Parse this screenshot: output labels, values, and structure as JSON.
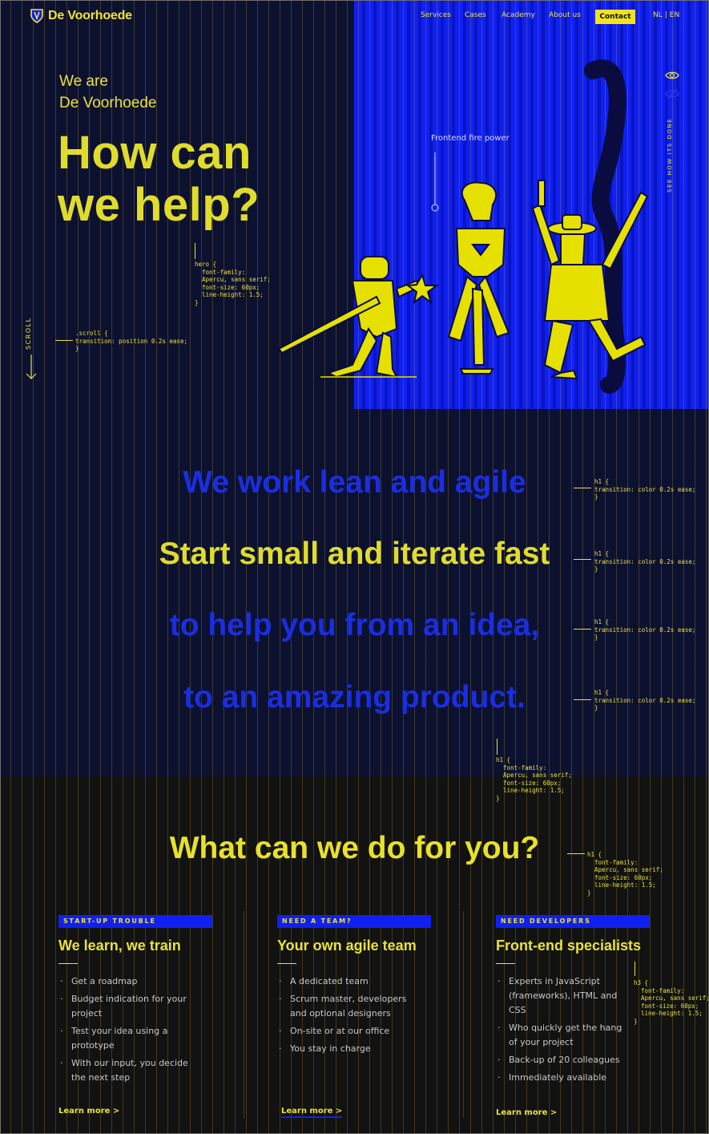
{
  "header": {
    "logo_text": "De Voorhoede",
    "nav": [
      "Services",
      "Cases",
      "Academy",
      "About us"
    ],
    "contact_label": "Contact",
    "lang_nl": "NL",
    "lang_sep": "|",
    "lang_en": "EN"
  },
  "hero": {
    "intro_line1": "We are",
    "intro_line2": "De Voorhoede",
    "title_line1": "How can",
    "title_line2": "we help?",
    "frontend_label": "Frontend fire power",
    "scroll_label": "SCROLL",
    "see_how_label": "SEE HOW ITS DONE",
    "hero_code": "hero {\n  font-family:\n  Apercu, sans serif;\n  font-size: 60px;\n  line-height: 1.5;\n}",
    "scroll_code": ".scroll {\ntransition: position 0.2s ease;\n}"
  },
  "agile": {
    "lines": [
      "We work lean and agile",
      "Start small and iterate fast",
      "to help you from an idea,",
      "to an amazing product."
    ],
    "line_code": "h1 {\ntransition: color 0.2s ease;\n}",
    "block_code": "h1 {\n  font-family:\n  Apercu, sans serif;\n  font-size: 60px;\n  line-height: 1.5;\n}"
  },
  "services": {
    "title": "What can we do for you?",
    "title_code": "h1 {\n  font-family:\n  Apercu, sans serif;\n  font-size: 60px;\n  line-height: 1.5;\n}",
    "h3_code": "h3 {\n  font-family:\n  Apercu, sans serif;\n  font-size: 60px;\n  line-height: 1.5;\n}",
    "cards": [
      {
        "tag": "START-UP TROUBLE",
        "title": "We learn, we train",
        "items": [
          "Get a roadmap",
          "Budget indication for your project",
          "Test your idea using a prototype",
          "With our input, you decide the next step"
        ],
        "link": "Learn more  >"
      },
      {
        "tag": "NEED A TEAM?",
        "title": "Your own agile team",
        "items": [
          "A dedicated team",
          "Scrum master, developers and optional designers",
          "On-site or at our office",
          "You stay in charge"
        ],
        "link": "Learn more  >"
      },
      {
        "tag": "NEED DEVELOPERS",
        "title": "Front-end specialists",
        "items": [
          "Experts in JavaScript (frameworks), HTML and CSS",
          "Who quickly get the hang of your project",
          "Back-up of 20 colleagues",
          "Immediately available"
        ],
        "link": "Learn more  >"
      }
    ]
  },
  "colors": {
    "navy": "#0d1130",
    "blue": "#1020f0",
    "yellow": "#e9e23a",
    "dark": "#121212"
  },
  "icons": [
    "shield-logo-icon",
    "eye-icon",
    "eye-slash-icon",
    "arrow-down-icon"
  ]
}
